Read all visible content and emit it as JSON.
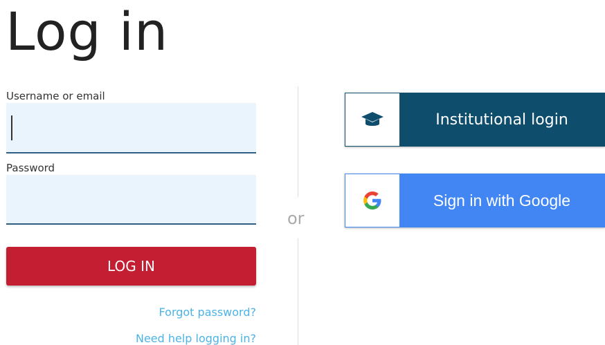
{
  "title": "Log in",
  "username": {
    "label": "Username or email",
    "value": ""
  },
  "password": {
    "label": "Password",
    "value": ""
  },
  "login_button": "LOG IN",
  "links": {
    "forgot": "Forgot password?",
    "help": "Need help logging in?"
  },
  "separator": "or",
  "sso": [
    {
      "label": "Institutional login",
      "icon": "graduation-cap-icon",
      "color": "#0e4d6c"
    },
    {
      "label": "Sign in with Google",
      "icon": "google-logo-icon",
      "color": "#4286f4"
    }
  ],
  "colors": {
    "primary": "#c41e33",
    "link": "#4cb3e6",
    "field_bg": "#eaf4fd"
  }
}
